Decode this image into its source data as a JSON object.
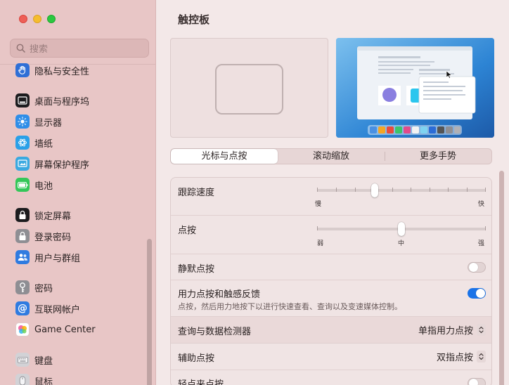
{
  "window": {
    "title": "触控板"
  },
  "sidebar": {
    "search_placeholder": "搜索",
    "items": [
      {
        "label": "隐私与安全性",
        "icon": "hand-icon",
        "color": "#2f6fd6"
      },
      {
        "label": "桌面与程序坞",
        "icon": "dock-icon",
        "color": "#1c1c1e"
      },
      {
        "label": "显示器",
        "icon": "sun-icon",
        "color": "#2f8ee8"
      },
      {
        "label": "墙纸",
        "icon": "flower-icon",
        "color": "#2aa0e8"
      },
      {
        "label": "屏幕保护程序",
        "icon": "screensaver-icon",
        "color": "#3aa9e0"
      },
      {
        "label": "电池",
        "icon": "battery-icon",
        "color": "#34c759"
      },
      {
        "label": "锁定屏幕",
        "icon": "lock-screen-icon",
        "color": "#1c1c1e"
      },
      {
        "label": "登录密码",
        "icon": "padlock-icon",
        "color": "#8e8e93"
      },
      {
        "label": "用户与群组",
        "icon": "users-icon",
        "color": "#2f7be0"
      },
      {
        "label": "密码",
        "icon": "key-icon",
        "color": "#8e8e93"
      },
      {
        "label": "互联网帐户",
        "icon": "at-icon",
        "color": "#2f7be0"
      },
      {
        "label": "Game Center",
        "icon": "game-center-icon",
        "color": "#ffffff"
      },
      {
        "label": "键盘",
        "icon": "keyboard-icon",
        "color": "#b8b8bd"
      },
      {
        "label": "鼠标",
        "icon": "mouse-icon",
        "color": "#b8b8bd"
      }
    ]
  },
  "tabs": [
    {
      "label": "光标与点按",
      "active": true
    },
    {
      "label": "滚动缩放",
      "active": false
    },
    {
      "label": "更多手势",
      "active": false
    }
  ],
  "settings": {
    "tracking_speed": {
      "label": "跟踪速度",
      "min_label": "慢",
      "max_label": "快",
      "value_fraction": 0.34
    },
    "click": {
      "label": "点按",
      "low": "弱",
      "mid": "中",
      "high": "强",
      "value_fraction": 0.5
    },
    "silent_click": {
      "label": "静默点按",
      "on": false
    },
    "force_click": {
      "label": "用力点按和触感反馈",
      "description": "点按，然后用力地按下以进行快速查看、查询以及变速媒体控制。",
      "on": true
    },
    "lookup": {
      "label": "查询与数据检测器",
      "value": "单指用力点按"
    },
    "secondary_click": {
      "label": "辅助点按",
      "value": "双指点按"
    },
    "tap_to_click": {
      "label": "轻点来点按",
      "on": false
    }
  },
  "colors": {
    "accent": "#1a73e8",
    "sidebar_bg": "#e8c6c6",
    "content_bg": "#f3e8e8"
  }
}
